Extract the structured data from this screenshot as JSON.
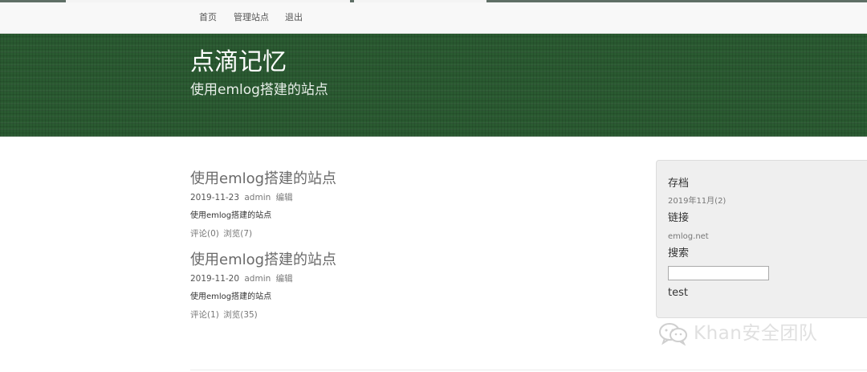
{
  "nav": {
    "items": [
      {
        "label": "首页"
      },
      {
        "label": "管理站点"
      },
      {
        "label": "退出"
      }
    ]
  },
  "header": {
    "title": "点滴记忆",
    "subtitle": "使用emlog搭建的站点"
  },
  "posts": [
    {
      "title": "使用emlog搭建的站点",
      "date": "2019-11-23",
      "author": "admin",
      "edit_label": "编辑",
      "excerpt": "使用emlog搭建的站点",
      "comments": "评论(0)",
      "views": "浏览(7)"
    },
    {
      "title": "使用emlog搭建的站点",
      "date": "2019-11-20",
      "author": "admin",
      "edit_label": "编辑",
      "excerpt": "使用emlog搭建的站点",
      "comments": "评论(1)",
      "views": "浏览(35)"
    }
  ],
  "sidebar": {
    "archive_heading": "存档",
    "archive_item": "2019年11月(2)",
    "links_heading": "链接",
    "links_item": "emlog.net",
    "search_heading": "搜索",
    "search_value": "",
    "test_label": "test"
  },
  "watermark": {
    "text": "Khan安全团队",
    "icon": "wechat-icon"
  },
  "colors": {
    "header_bg": "#2a5a31",
    "nav_bg": "#f8f8f8",
    "sidebar_bg": "#efefef"
  }
}
